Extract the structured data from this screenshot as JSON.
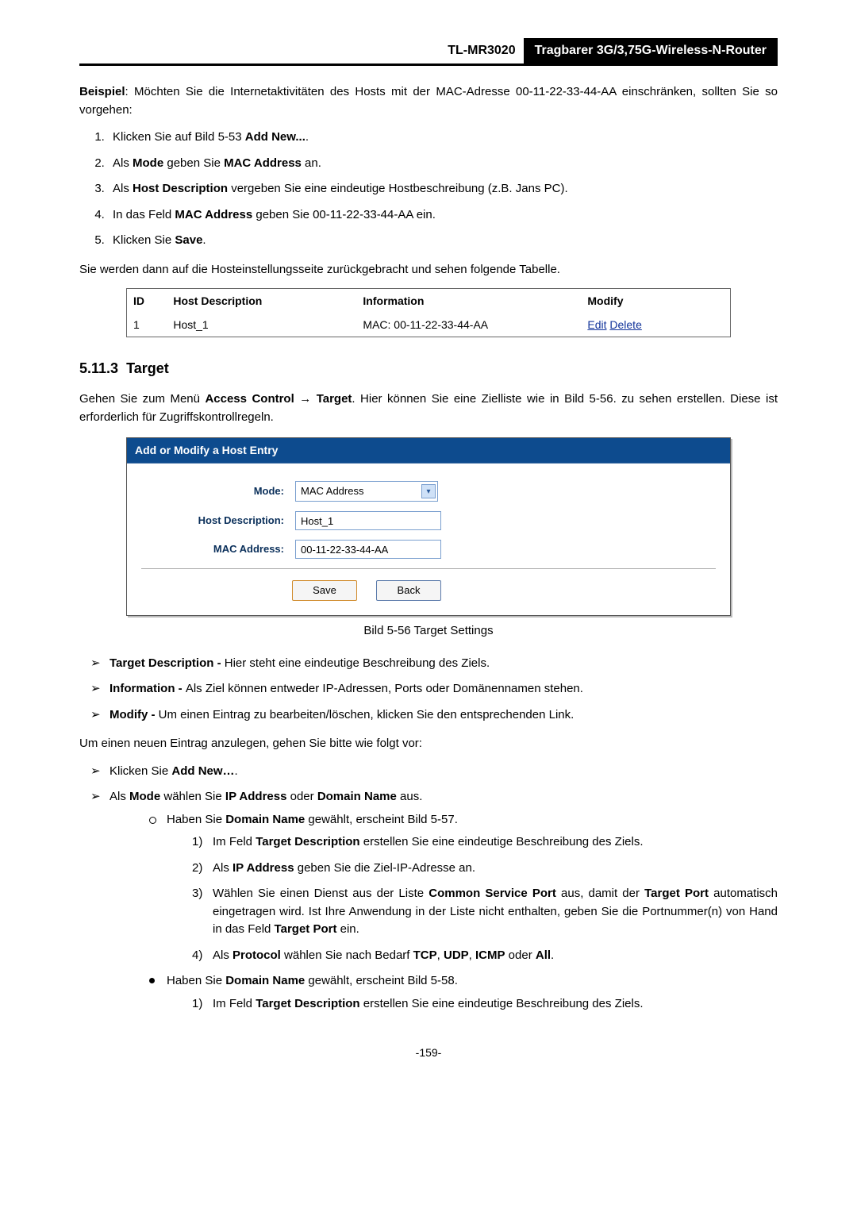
{
  "header": {
    "model": "TL-MR3020",
    "subtitle": "Tragbarer 3G/3,75G-Wireless-N-Router"
  },
  "intro": {
    "label": "Beispiel",
    "text_after": ": Möchten Sie die Internetaktivitäten des Hosts mit der MAC-Adresse 00-11-22-33-44-AA einschränken, sollten Sie so vorgehen:"
  },
  "steps": {
    "s1_a": "Klicken Sie auf Bild 5-53 ",
    "s1_b": "Add New...",
    "s1_c": ".",
    "s2_a": "Als ",
    "s2_b": "Mode",
    "s2_c": " geben Sie ",
    "s2_d": "MAC Address",
    "s2_e": " an.",
    "s3_a": "Als ",
    "s3_b": "Host Description",
    "s3_c": " vergeben Sie eine eindeutige Hostbeschreibung (z.B. Jans PC).",
    "s4_a": "In das Feld ",
    "s4_b": "MAC Address",
    "s4_c": " geben Sie 00-11-22-33-44-AA ein.",
    "s5_a": "Klicken Sie ",
    "s5_b": "Save",
    "s5_c": "."
  },
  "after_steps": "Sie werden dann auf die Hosteinstellungsseite zurückgebracht und sehen folgende Tabelle.",
  "host_table": {
    "h_id": "ID",
    "h_hd": "Host Description",
    "h_info": "Information",
    "h_mod": "Modify",
    "r1_id": "1",
    "r1_hd": "Host_1",
    "r1_info": "MAC: 00-11-22-33-44-AA",
    "r1_edit": "Edit",
    "r1_del": "Delete"
  },
  "section": {
    "num": "5.11.3",
    "title": "Target"
  },
  "target_intro_a": "Gehen Sie zum Menü ",
  "target_intro_b": "Access Control → Target",
  "target_intro_c": ". Hier können Sie eine Zielliste wie in Bild 5-56. zu sehen erstellen. Diese ist erforderlich für Zugriffskontrollregeln.",
  "panel": {
    "title": "Add or Modify a Host Entry",
    "mode_label": "Mode:",
    "mode_value": "MAC Address",
    "hd_label": "Host Description:",
    "hd_value": "Host_1",
    "mac_label": "MAC Address:",
    "mac_value": "00-11-22-33-44-AA",
    "save": "Save",
    "back": "Back"
  },
  "caption": "Bild 5-56 Target Settings",
  "defs": {
    "d1_a": "Target Description - ",
    "d1_b": "Hier steht eine eindeutige Beschreibung des Ziels.",
    "d2_a": "Information - ",
    "d2_b": "Als Ziel können entweder IP-Adressen, Ports oder Domänennamen stehen.",
    "d3_a": "Modify - ",
    "d3_b": "Um einen Eintrag zu bearbeiten/löschen, klicken Sie den entsprechenden Link."
  },
  "new_entry_intro": "Um einen neuen Eintrag anzulegen, gehen Sie bitte wie folgt vor:",
  "ne": {
    "a1_a": "Klicken Sie ",
    "a1_b": "Add New…",
    "a1_c": ".",
    "a2_a": "Als ",
    "a2_b": "Mode",
    "a2_c": " wählen Sie ",
    "a2_d": "IP Address",
    "a2_e": " oder ",
    "a2_f": "Domain Name",
    "a2_g": " aus.",
    "b1_a": "Haben Sie ",
    "b1_b": "Domain Name",
    "b1_c": " gewählt, erscheint Bild 5-57.",
    "c1_a": "Im Feld ",
    "c1_b": "Target Description",
    "c1_c": " erstellen Sie eine eindeutige Beschreibung des Ziels.",
    "c2_a": "Als ",
    "c2_b": "IP Address",
    "c2_c": " geben Sie die Ziel-IP-Adresse an.",
    "c3_a": "Wählen Sie einen Dienst aus der Liste ",
    "c3_b": "Common Service Port",
    "c3_c": " aus, damit der ",
    "c3_d": "Target Port",
    "c3_e": " automatisch eingetragen wird. Ist Ihre Anwendung in der Liste nicht enthalten, geben Sie die Portnummer(n) von Hand in das Feld ",
    "c3_f": "Target Port",
    "c3_g": " ein.",
    "c4_a": "Als ",
    "c4_b": "Protocol",
    "c4_c": " wählen Sie nach Bedarf ",
    "c4_d": "TCP",
    "c4_e": ", ",
    "c4_f": "UDP",
    "c4_g": ", ",
    "c4_h": "ICMP",
    "c4_i": " oder ",
    "c4_j": "All",
    "c4_k": ".",
    "b2_a": "Haben Sie ",
    "b2_b": "Domain Name",
    "b2_c": " gewählt, erscheint Bild 5-58.",
    "d1_a": "Im Feld ",
    "d1_b": "Target Description",
    "d1_c": " erstellen Sie eine eindeutige Beschreibung des Ziels."
  },
  "footer": "-159-"
}
